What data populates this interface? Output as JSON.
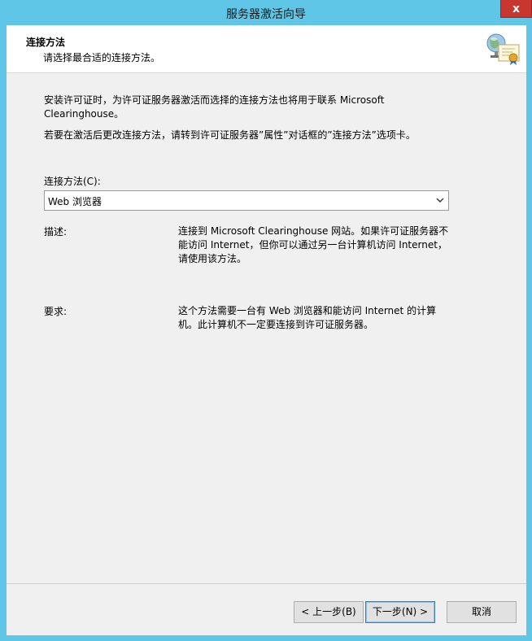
{
  "window": {
    "title": "服务器激活向导",
    "close_glyph": "x"
  },
  "header": {
    "title": "连接方法",
    "subtitle": "请选择最合适的连接方法。",
    "icon": "certificate-icon"
  },
  "content": {
    "paragraph1": "安装许可证时，为许可证服务器激活而选择的连接方法也将用于联系 Microsoft Clearinghouse。",
    "paragraph2": "若要在激活后更改连接方法，请转到许可证服务器”属性”对话框的”连接方法”选项卡。",
    "method_label": "连接方法(C):",
    "method_selected": "Web 浏览器",
    "description_label": "描述:",
    "description_text": "连接到 Microsoft Clearinghouse 网站。如果许可证服务器不能访问 Internet，但你可以通过另一台计算机访问 Internet，请使用该方法。",
    "requirements_label": "要求:",
    "requirements_text": "这个方法需要一台有 Web 浏览器和能访问 Internet 的计算机。此计算机不一定要连接到许可证服务器。"
  },
  "buttons": {
    "back": "< 上一步(B)",
    "next": "下一步(N) >",
    "cancel": "取消"
  }
}
